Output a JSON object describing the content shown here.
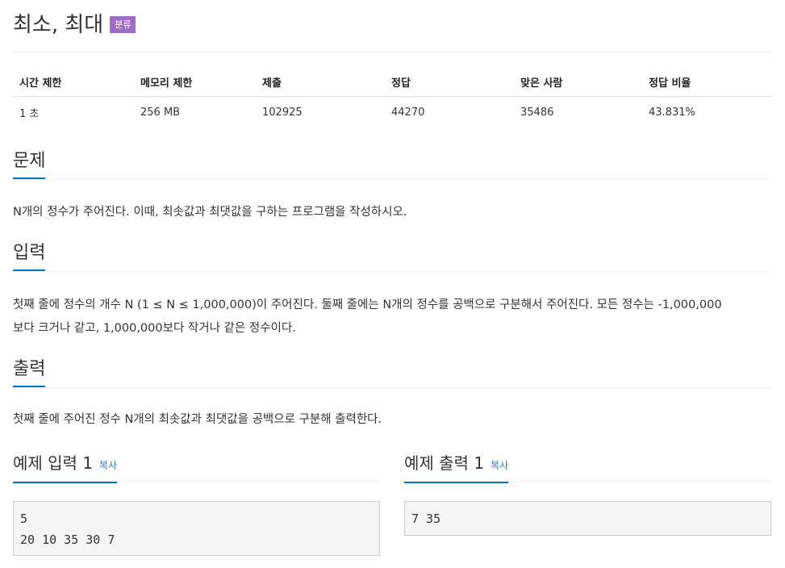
{
  "problem": {
    "title": "최소, 최대",
    "tag_label": "분류"
  },
  "info_table": {
    "headers": [
      "시간 제한",
      "메모리 제한",
      "제출",
      "정답",
      "맞은 사람",
      "정답 비율"
    ],
    "row": [
      "1 초",
      "256 MB",
      "102925",
      "44270",
      "35486",
      "43.831%"
    ]
  },
  "sections": {
    "problem": {
      "heading": "문제",
      "text": "N개의 정수가 주어진다. 이때, 최솟값과 최댓값을 구하는 프로그램을 작성하시오."
    },
    "input": {
      "heading": "입력",
      "line1": "첫째 줄에 정수의 개수 N (1 ≤ N ≤ 1,000,000)이 주어진다. 둘째 줄에는 N개의 정수를 공백으로 구분해서 주어진다. 모든 정수는 -1,000,000",
      "line2": "보다 크거나 같고, 1,000,000보다 작거나 같은 정수이다."
    },
    "output": {
      "heading": "출력",
      "text": "첫째 줄에 주어진 정수 N개의 최솟값과 최댓값을 공백으로 구분해 출력한다."
    }
  },
  "samples": {
    "input": {
      "heading": "예제 입력 1",
      "copy_label": "복사",
      "content": "5\n20 10 35 30 7"
    },
    "output": {
      "heading": "예제 출력 1",
      "copy_label": "복사",
      "content": "7 35"
    }
  },
  "colors": {
    "accent_blue": "#0076c0",
    "tag_purple": "#a06dc4",
    "link_blue": "#337ab7"
  }
}
